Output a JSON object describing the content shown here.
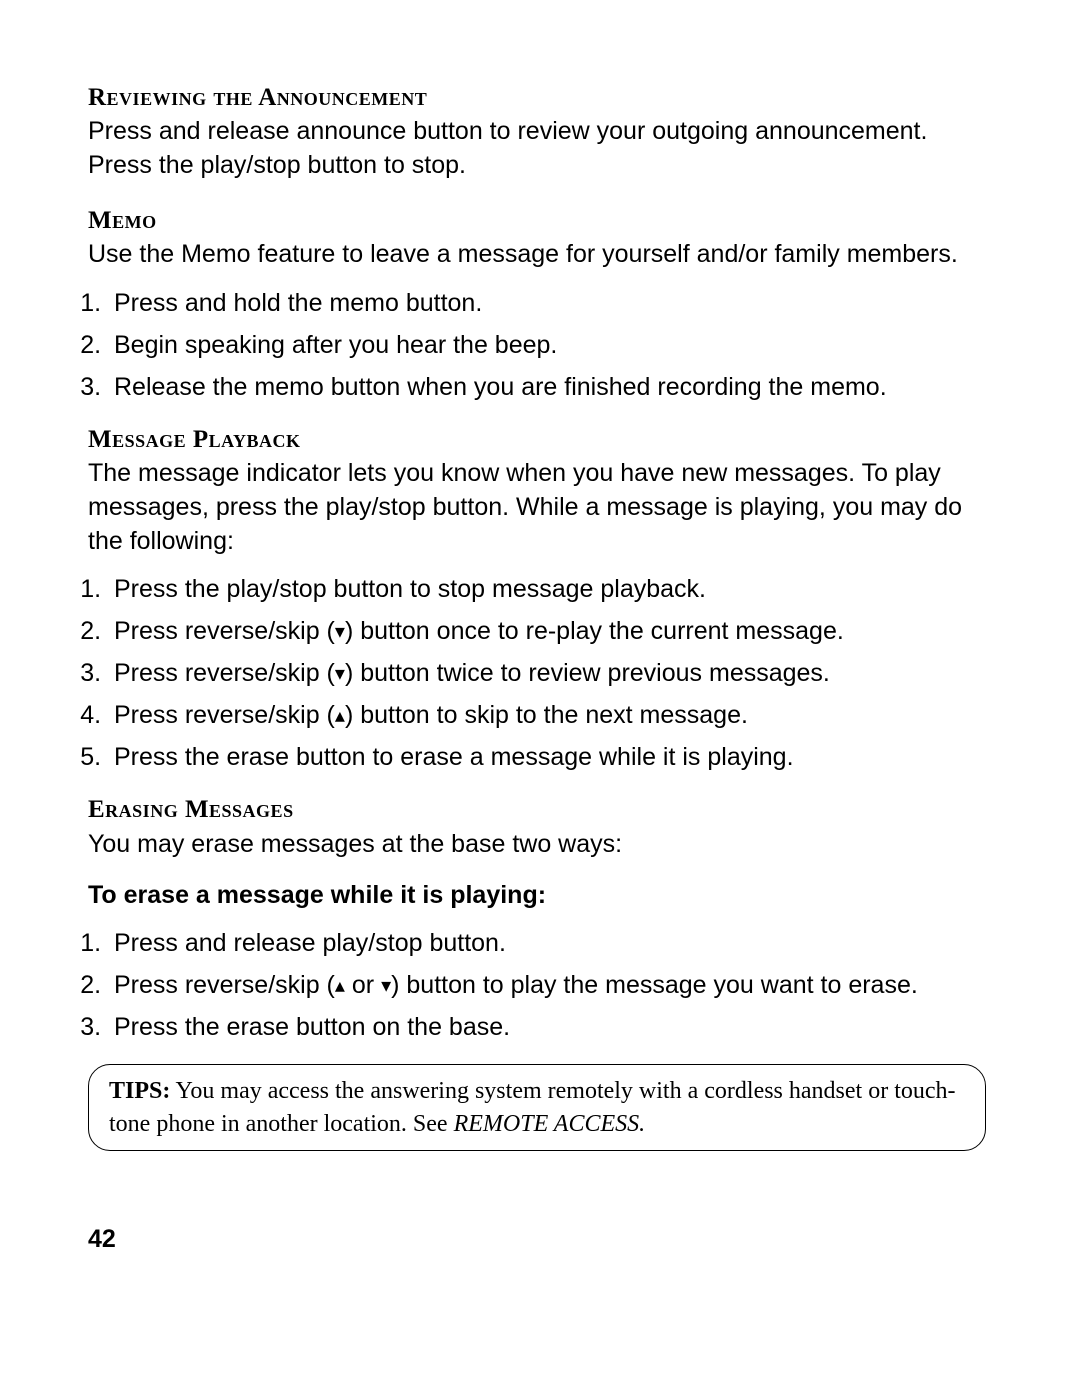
{
  "section1": {
    "heading": "Reviewing the Announcement",
    "body": "Press and release announce button to review your outgoing announcement. Press the play/stop button to stop."
  },
  "section2": {
    "heading": "Memo",
    "body": "Use the Memo feature to leave a message for yourself and/or family members.",
    "steps": [
      "Press and hold the memo button.",
      "Begin speaking after you hear the beep.",
      "Release the memo button when you are finished recording the memo."
    ]
  },
  "section3": {
    "heading": "Message Playback",
    "body": "The message indicator lets you know when you have new messages. To play messages, press the play/stop button. While a message is playing, you may do the following:",
    "step1": "Press the play/stop button to stop message playback.",
    "step2a": "Press reverse/skip (",
    "step2b": ") button once to re-play the current message.",
    "step3a": "Press reverse/skip (",
    "step3b": ") button twice to review previous messages.",
    "step4a": "Press reverse/skip (",
    "step4b": ") button to skip to the next message.",
    "step5": "Press the erase button to erase a message while it is playing."
  },
  "section4": {
    "heading": "Erasing Messages",
    "body": "You may erase messages at the base two ways:",
    "subheading": "To erase a message while it is playing:",
    "step1": "Press and release play/stop button.",
    "step2a": "Press reverse/skip (",
    "step2mid": " or ",
    "step2b": ") button to play the message you want to erase.",
    "step3": "Press the erase button on the base."
  },
  "tips": {
    "label": "TIPS:",
    "body": " You may access the answering system remotely with a cordless handset or touch-tone phone in another location. See ",
    "ref": "REMOTE ACCESS."
  },
  "arrows": {
    "down": "▾",
    "up": "▴"
  },
  "page": "42"
}
